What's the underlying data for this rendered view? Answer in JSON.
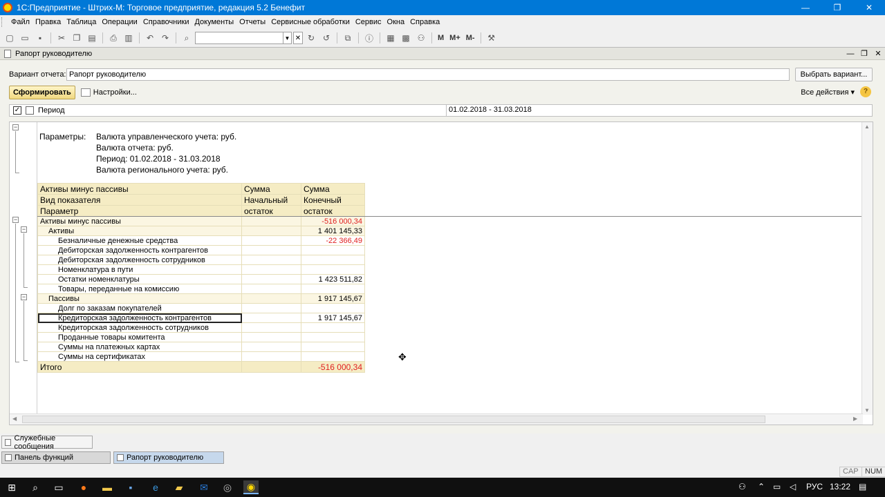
{
  "window": {
    "title": "1С:Предприятие - Штрих-М: Торговое предприятие, редакция 5.2 Бенефит",
    "minimize": "—",
    "maximize": "❐",
    "close": "✕"
  },
  "menu": [
    "Файл",
    "Правка",
    "Таблица",
    "Операции",
    "Справочники",
    "Документы",
    "Отчеты",
    "Сервисные обработки",
    "Сервис",
    "Окна",
    "Справка"
  ],
  "toolbar": {
    "buttons_text": [
      "M",
      "M+",
      "M-"
    ]
  },
  "document": {
    "title": "Рапорт руководителю",
    "variant_label": "Вариант отчета:",
    "variant_value": "Рапорт руководителю",
    "choose_variant": "Выбрать вариант...",
    "form_button": "Сформировать",
    "settings": "Настройки...",
    "all_actions": "Все действия",
    "help": "?",
    "period_label": "Период",
    "period_value": "01.02.2018 - 31.03.2018"
  },
  "report": {
    "params_label": "Параметры:",
    "params": [
      "Валюта управленческого учета: руб.",
      "Валюта отчета: руб.",
      "Период: 01.02.2018 - 31.03.2018",
      "Валюта регионального учета: руб."
    ],
    "header": [
      [
        "Активы минус пассивы",
        "Сумма",
        "Сумма"
      ],
      [
        "Вид показателя",
        "Начальный",
        "Конечный"
      ],
      [
        "Параметр",
        "остаток",
        "остаток"
      ]
    ],
    "rows": [
      {
        "label": "Активы минус пассивы",
        "start": "",
        "end": "-516 000,34"
      },
      {
        "label": "Активы",
        "start": "",
        "end": "1 401 145,33"
      },
      {
        "label": "Безналичные денежные средства",
        "start": "",
        "end": "-22 366,49"
      },
      {
        "label": "Дебиторская задолженность контрагентов",
        "start": "",
        "end": ""
      },
      {
        "label": "Дебиторская задолженность сотрудников",
        "start": "",
        "end": ""
      },
      {
        "label": "Номенклатура в пути",
        "start": "",
        "end": ""
      },
      {
        "label": "Остатки номенклатуры",
        "start": "",
        "end": "1 423 511,82"
      },
      {
        "label": "Товары, переданные на комиссию",
        "start": "",
        "end": ""
      },
      {
        "label": "Пассивы",
        "start": "",
        "end": "1 917 145,67"
      },
      {
        "label": "Долг по заказам покупателей",
        "start": "",
        "end": ""
      },
      {
        "label": "Кредиторская задолженность контрагентов",
        "start": "",
        "end": "1 917 145,67"
      },
      {
        "label": "Кредиторская задолженность сотрудников",
        "start": "",
        "end": ""
      },
      {
        "label": "Проданные товары комитента",
        "start": "",
        "end": ""
      },
      {
        "label": "Суммы на платежных картах",
        "start": "",
        "end": ""
      },
      {
        "label": "Суммы на сертификатах",
        "start": "",
        "end": ""
      }
    ],
    "total_label": "Итого",
    "total_start": "",
    "total_end": "-516 000,34"
  },
  "bottom": {
    "messages_tab": "Служебные сообщения",
    "tab_functions": "Панель функций",
    "tab_report": "Рапорт руководителю",
    "cap": "CAP",
    "num": "NUM"
  },
  "taskbar": {
    "lang": "РУС",
    "time": "13:22"
  },
  "icons": [
    "app-1c-icon",
    "new-doc-icon",
    "open-icon",
    "save-icon",
    "cut-icon",
    "copy-icon",
    "paste-icon",
    "print-icon",
    "undo-icon",
    "redo-icon",
    "find-icon",
    "info-icon",
    "calculator-icon",
    "calendar-icon",
    "windows-start-icon",
    "search-icon",
    "taskview-icon",
    "firefox-icon",
    "explorer-icon",
    "edge-icon",
    "outlook-icon"
  ],
  "colors": {
    "titlebar": "#0078d7",
    "negative": "#e02020",
    "header_fill": "#f5ecc4",
    "form_button": "#f0d880"
  }
}
